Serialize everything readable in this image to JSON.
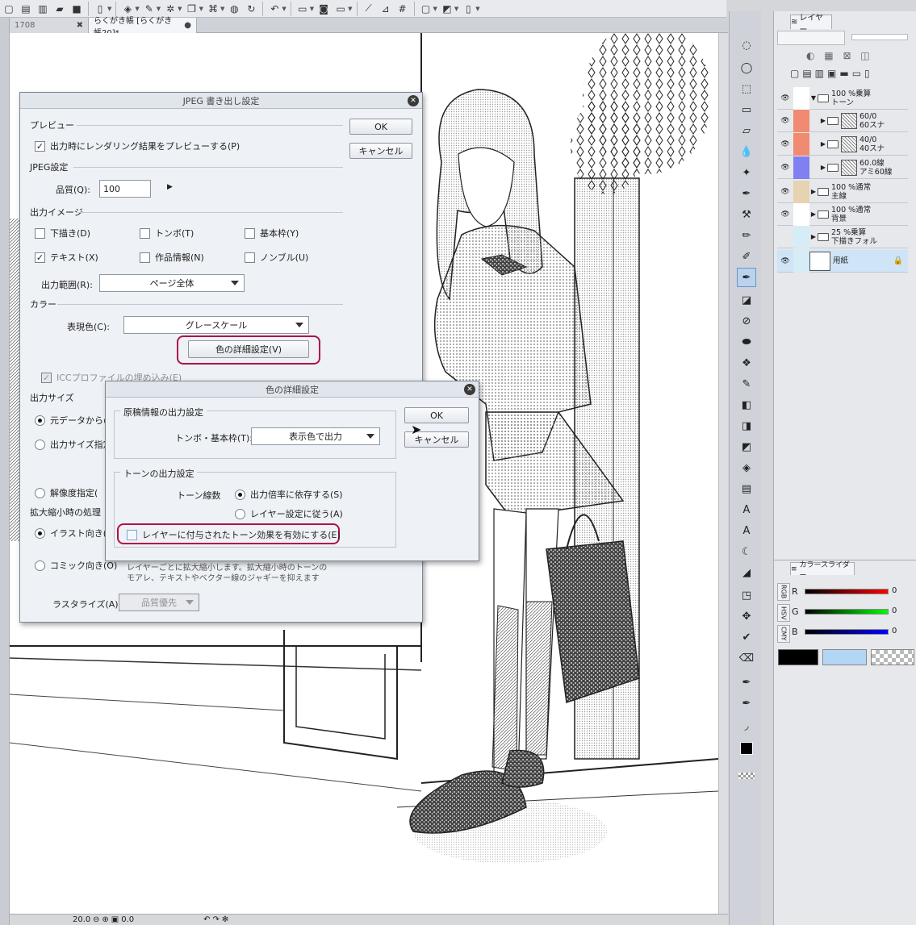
{
  "tabs": [
    {
      "label": "1708",
      "active": false
    },
    {
      "label": "らくがき帳 [らくがき帳20]*",
      "active": true
    }
  ],
  "status": {
    "zoom": "20.0",
    "angle": "0.0"
  },
  "jpeg_dialog": {
    "title": "JPEG 書き出し設定",
    "ok": "OK",
    "cancel": "キャンセル",
    "preview_section": "プレビュー",
    "preview_checkbox": "出力時にレンダリング結果をプレビューする(P)",
    "jpeg_section": "JPEG設定",
    "quality_label": "品質(Q):",
    "quality_value": "100",
    "image_section": "出力イメージ",
    "cb_draft": "下描き(D)",
    "cb_tombo": "トンボ(T)",
    "cb_basic_frame": "基本枠(Y)",
    "cb_text": "テキスト(X)",
    "cb_work_info": "作品情報(N)",
    "cb_nombre": "ノンブル(U)",
    "range_label": "出力範囲(R):",
    "range_value": "ページ全体",
    "color_section": "カラー",
    "expression_label": "表現色(C):",
    "expression_value": "グレースケール",
    "detail_button": "色の詳細設定(V)",
    "icc_checkbox": "ICCプロファイルの埋め込み(E)",
    "size_section": "出力サイズ",
    "radio_original": "元データからの",
    "radio_size": "出力サイズ指定",
    "radio_resolution": "解像度指定(",
    "scale_section": "拡大縮小時の処理",
    "radio_illust": "イラスト向き(I)",
    "radio_comic": "コミック向き(O)",
    "comic_desc_1": "レイヤーごとに拡大縮小します。拡大縮小時のトーンの",
    "comic_desc_2": "モアレ、テキストやベクター線のジャギーを抑えます",
    "rasterize_label": "ラスタライズ(A):",
    "rasterize_value": "品質優先"
  },
  "color_dialog": {
    "title": "色の詳細設定",
    "ok": "OK",
    "cancel": "キャンセル",
    "manuscript_group": "原稿情報の出力設定",
    "tombo_label": "トンボ・基本枠(T):",
    "tombo_value": "表示色で出力",
    "tone_group": "トーンの出力設定",
    "tone_lines_label": "トーン線数",
    "radio_output_scale": "出力倍率に依存する(S)",
    "radio_layer_settings": "レイヤー設定に従う(A)",
    "tone_effect_checkbox": "レイヤーに付与されたトーン効果を有効にする(E)"
  },
  "layer_panel": {
    "tab_label": "レイヤー",
    "layers": [
      {
        "line1": "100 %乗算",
        "line2": "トーン",
        "color": "#ffffff",
        "type": "folder",
        "indent": 0,
        "eye": true
      },
      {
        "line1": "60/0",
        "line2": "60スナ",
        "color": "#f08a70",
        "type": "tone",
        "indent": 1,
        "eye": true
      },
      {
        "line1": "40/0",
        "line2": "40スナ",
        "color": "#f08a70",
        "type": "tone",
        "indent": 1,
        "eye": true
      },
      {
        "line1": "60.0線",
        "line2": "アミ60線",
        "color": "#8080f0",
        "type": "tone",
        "indent": 1,
        "eye": true
      },
      {
        "line1": "100 %通常",
        "line2": "主線",
        "color": "#e6d3b0",
        "type": "folder",
        "indent": 0,
        "eye": true
      },
      {
        "line1": "100 %通常",
        "line2": "背景",
        "color": "#ffffff",
        "type": "folder",
        "indent": 0,
        "eye": true
      },
      {
        "line1": "25 %乗算",
        "line2": "下描きフォル",
        "color": "#d6ecf6",
        "type": "folder",
        "indent": 0,
        "eye": false
      },
      {
        "line1": "用紙",
        "line2": "",
        "color": "#d6ecf6",
        "type": "paper",
        "indent": 0,
        "eye": true
      }
    ]
  },
  "color_slider": {
    "tab_label": "カラースライダー",
    "modes": [
      "RGB",
      "HSV",
      "CMY"
    ],
    "r_label": "R",
    "r_value": "0",
    "g_label": "G",
    "g_value": "0",
    "b_label": "B",
    "b_value": "0",
    "main_color": "#000000",
    "sub_color": "#b3d6f7"
  }
}
